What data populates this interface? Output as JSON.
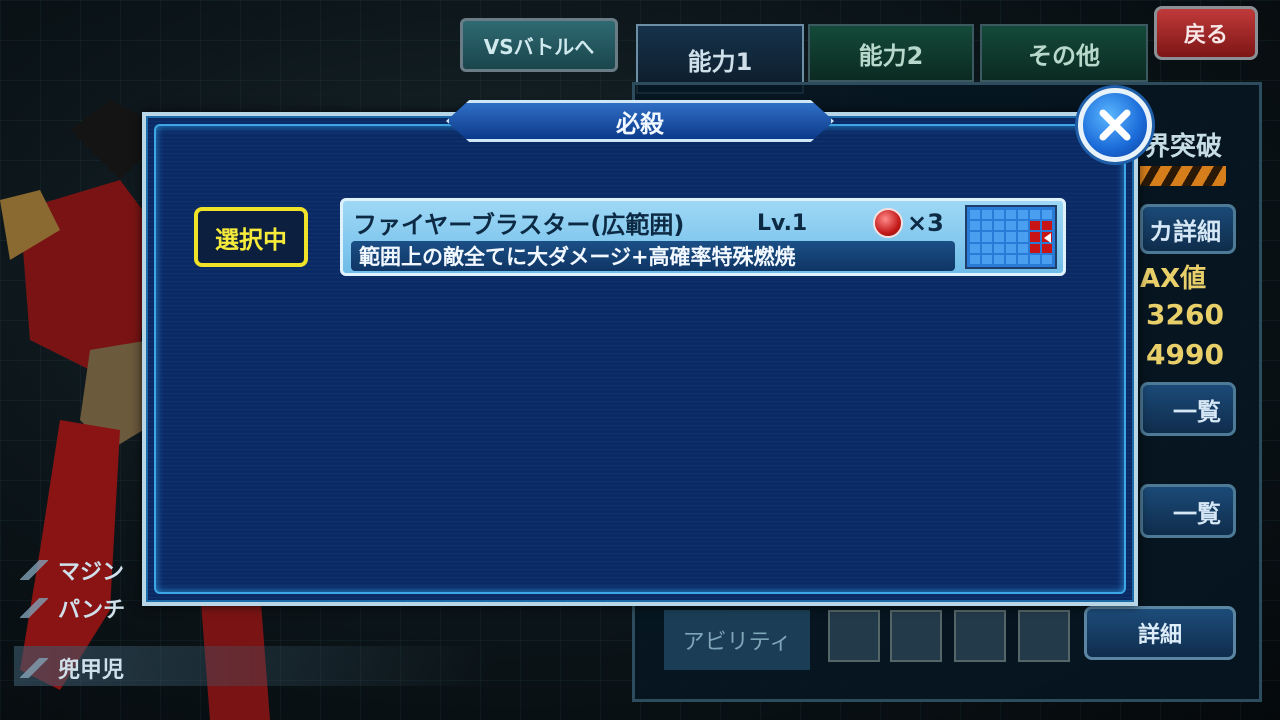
{
  "top": {
    "vs_battle_label": "VSバトルへ",
    "tabs": [
      "能力1",
      "能力2",
      "その他"
    ],
    "back_label": "戻る"
  },
  "right_panel": {
    "limit_break": "界突破",
    "detail_power": "カ詳細",
    "max_value": "AX値",
    "value_1": "3260",
    "value_2": "4990",
    "list_1": "一覧",
    "list_2": "一覧",
    "ability_label": "アビリティ",
    "detail_label": "詳細"
  },
  "left": {
    "label_1": "マジン",
    "label_2": "パンチ",
    "name": "兜甲児"
  },
  "modal": {
    "title": "必殺",
    "selected_badge": "選択中",
    "skill": {
      "name": "ファイヤーブラスター(広範囲)",
      "level": "Lv.1",
      "multiplier": "×3",
      "description": "範囲上の敵全てに大ダメージ+高確率特殊燃焼",
      "range_hit_cells": [
        12,
        13,
        19,
        20,
        26,
        27
      ]
    }
  },
  "colors": {
    "modal_bg": "#0a2a66",
    "selected_yellow": "#f0e228",
    "back_red": "#c03a3a",
    "value_gold": "#e8cf6a"
  }
}
